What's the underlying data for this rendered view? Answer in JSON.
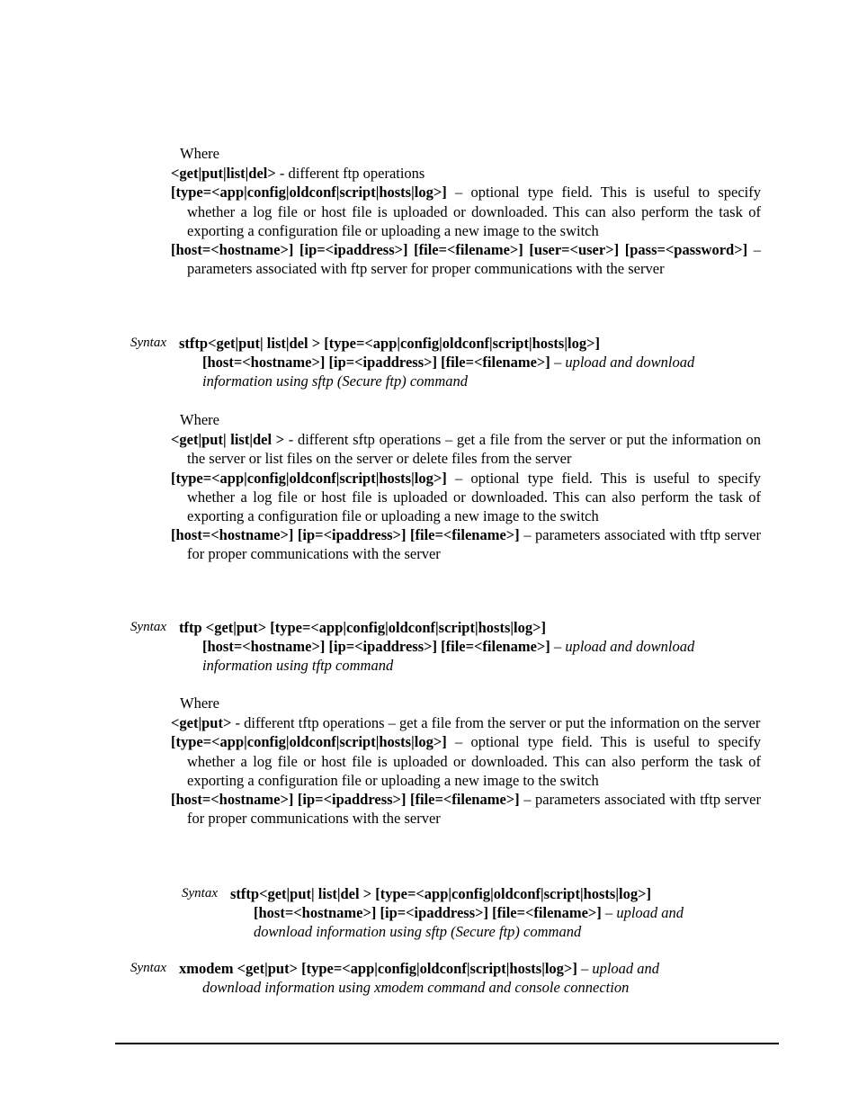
{
  "document": {
    "type": "technical-manual-page",
    "blocks": [
      {
        "id": "ftp-where",
        "where_label": "Where",
        "lines": [
          {
            "bold": "<get|put|list|del>",
            "rest": " - different ftp operations"
          },
          {
            "bold": "[type=<app|config|oldconf|script|hosts|log>]",
            "rest": " – optional type field. This is useful to specify whether a log file or host file is uploaded or downloaded. This can also perform the task of exporting a configuration file or uploading a new image to the switch"
          },
          {
            "bold": "[host=<hostname>]    [ip=<ipaddress>]    [file=<filename>]    [user=<user>]   [pass=<password>]",
            "rest": " – parameters associated with ftp server for proper communications with the server"
          }
        ]
      },
      {
        "id": "sftp-syntax",
        "label": "Syntax",
        "line1": "stftp<get|put|  list|del > [type=<app|config|oldconf|script|hosts|log>]",
        "line2": "[host=<hostname>] [ip=<ipaddress>] [file=<filename>] ",
        "line2_italic": "– upload and download",
        "line3_italic": "information using sftp (Secure ftp) command"
      },
      {
        "id": "sftp-where",
        "where_label": "Where",
        "lines": [
          {
            "bold": "<get|put|  list|del >",
            "rest": " - different sftp operations – get a file from the server or put the information on the server or list files on the server or delete files from the server"
          },
          {
            "bold": "[type=<app|config|oldconf|script|hosts|log>]",
            "rest": " – optional type field. This is useful to specify whether a log file or host file is uploaded or downloaded. This can also perform the task of exporting a configuration file or uploading a new image to the switch"
          },
          {
            "bold": "[host=<hostname>]  [ip=<ipaddress>]  [file=<filename>]",
            "rest": " – parameters associated with tftp server for proper communications with the server"
          }
        ]
      },
      {
        "id": "tftp-syntax",
        "label": "Syntax",
        "line1": "tftp <get|put> [type=<app|config|oldconf|script|hosts|log>]",
        "line2": "[host=<hostname>] [ip=<ipaddress>] [file=<filename>] ",
        "line2_italic": "– upload and download",
        "line3_italic": "information using tftp command"
      },
      {
        "id": "tftp-where",
        "where_label": "Where",
        "lines": [
          {
            "bold": "<get|put>",
            "rest": " - different tftp operations – get a file from the server or put the information on the server"
          },
          {
            "bold": "[type=<app|config|oldconf|script|hosts|log>]",
            "rest": " – optional type field. This is useful to specify whether a log file or host file is uploaded or downloaded. This can also perform the task of exporting a configuration file or uploading a new image to the switch"
          },
          {
            "bold": "[host=<hostname>]  [ip=<ipaddress>]  [file=<filename>]",
            "rest": " – parameters associated with tftp server for proper communications with the server"
          }
        ]
      },
      {
        "id": "sftp-syntax-2",
        "label": "Syntax",
        "line1": "stftp<get|put|  list|del > [type=<app|config|oldconf|script|hosts|log>]",
        "line2": "[host=<hostname>] [ip=<ipaddress>] [file=<filename>] ",
        "line2_italic": "– upload and",
        "line3_italic": "download information using sftp (Secure ftp) command"
      },
      {
        "id": "xmodem-syntax",
        "label": "Syntax",
        "line1": "xmodem <get|put> [type=<app|config|oldconf|script|hosts|log>] ",
        "line1_italic": "– upload and",
        "line2_italic": "download information using xmodem command and console connection"
      }
    ]
  }
}
